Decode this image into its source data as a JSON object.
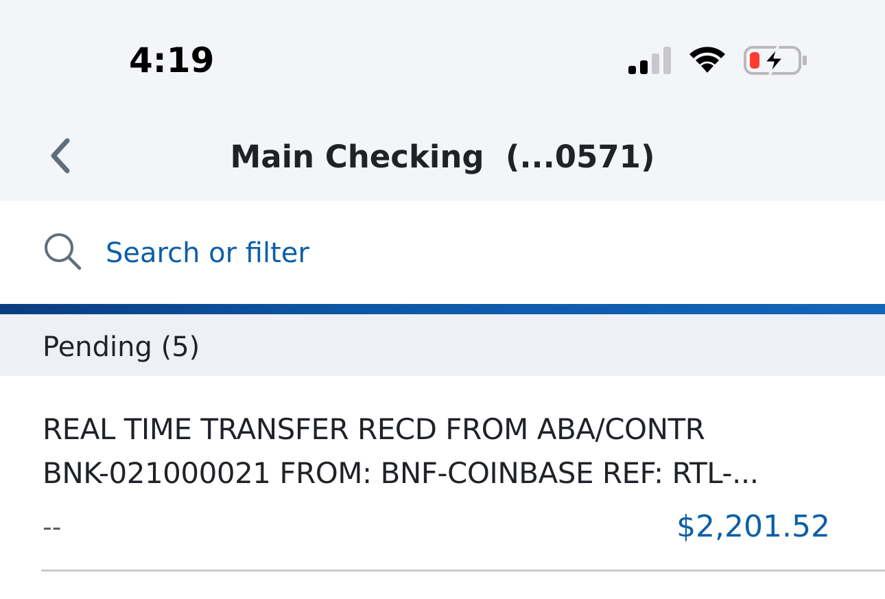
{
  "status_bar": {
    "time": "4:19",
    "icons": [
      "cellular-signal-icon",
      "wifi-icon",
      "battery-charging-icon"
    ],
    "battery_color": "#ff3b30"
  },
  "nav": {
    "back_icon": "chevron-left-icon",
    "title": "Main Checking  (...0571)"
  },
  "search": {
    "icon": "search-icon",
    "placeholder": "Search or filter"
  },
  "pending": {
    "label": "Pending (5)"
  },
  "transactions": [
    {
      "description_line1": "REAL TIME TRANSFER RECD FROM ABA/CONTR",
      "description_line2": "BNK-021000021 FROM: BNF-COINBASE REF: RTL-...",
      "date": "--",
      "amount": "$2,201.52"
    }
  ],
  "colors": {
    "accent": "#0b5fa8",
    "header_bg": "#f4f5f9",
    "section_bg": "#eef0f5"
  }
}
